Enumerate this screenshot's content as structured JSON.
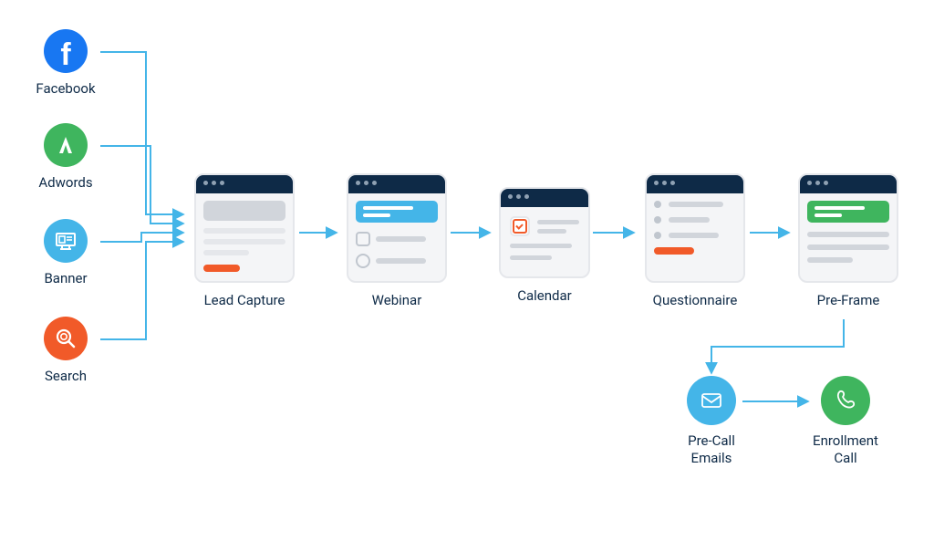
{
  "sources": {
    "facebook": "Facebook",
    "adwords": "Adwords",
    "banner": "Banner",
    "search": "Search"
  },
  "stages": {
    "lead_capture": "Lead Capture",
    "webinar": "Webinar",
    "calendar": "Calendar",
    "questionnaire": "Questionnaire",
    "pre_frame": "Pre-Frame"
  },
  "endpoints": {
    "pre_call_emails": "Pre-Call\nEmails",
    "enrollment_call": "Enrollment\nCall"
  },
  "colors": {
    "navy": "#0E2A47",
    "blue": "#1877F2",
    "sky": "#44B5E8",
    "green": "#3FB55E",
    "orange": "#F15A29",
    "grey": "#D1D5DB"
  }
}
